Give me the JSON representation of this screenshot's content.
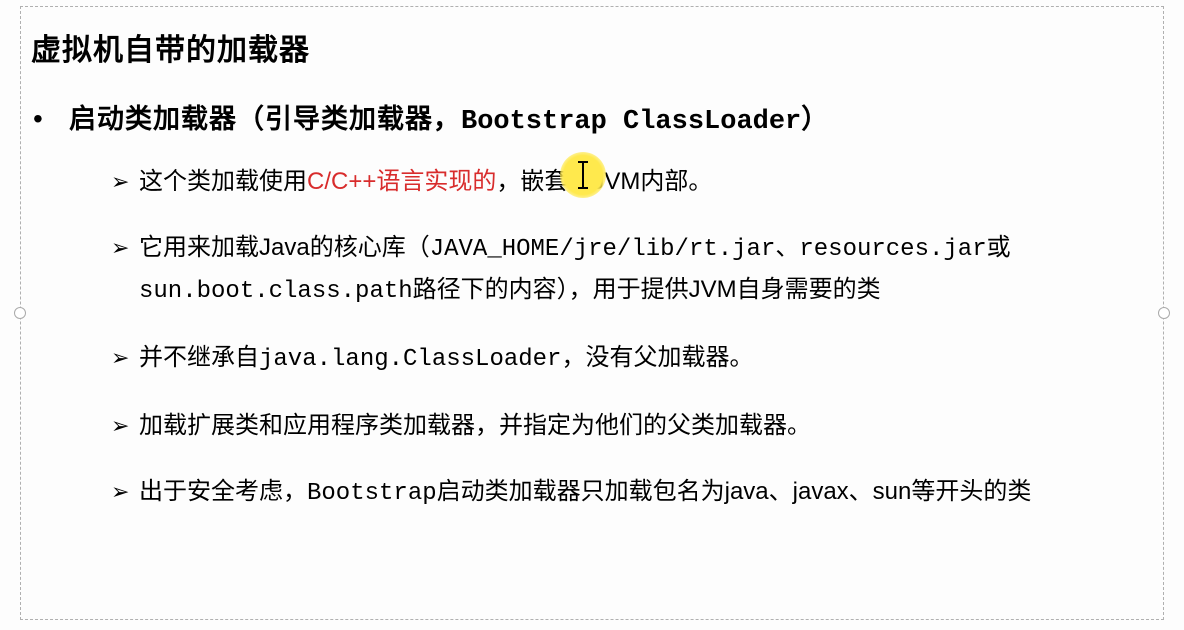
{
  "title": "虚拟机自带的加载器",
  "main_bullet": {
    "prefix": "启动类加载器（引导类加载器，",
    "mono": "Bootstrap ClassLoader",
    "suffix": "）"
  },
  "subitems": {
    "item1_before": "这个类加载使用",
    "item1_red": "C/C++语言实现的",
    "item1_after": "，嵌套在JVM内部。",
    "item2_a": "它用来加载Java的核心库（",
    "item2_mono1": "JAVA_HOME/jre/lib/rt.jar",
    "item2_b": "、",
    "item2_mono2": "resources.jar",
    "item2_c": "或",
    "item2_mono3": "sun.boot.class.path",
    "item2_d": "路径下的内容），用于提供JVM自身需要的类",
    "item3_a": "并不继承自",
    "item3_mono": "java.lang.ClassLoader",
    "item3_b": "，没有父加载器。",
    "item4": "加载扩展类和应用程序类加载器，并指定为他们的父类加载器。",
    "item5_a": "出于安全考虑，",
    "item5_mono": "Bootstrap",
    "item5_b": "启动类加载器只加载包名为java、javax、sun等开头的类"
  },
  "watermark": ""
}
